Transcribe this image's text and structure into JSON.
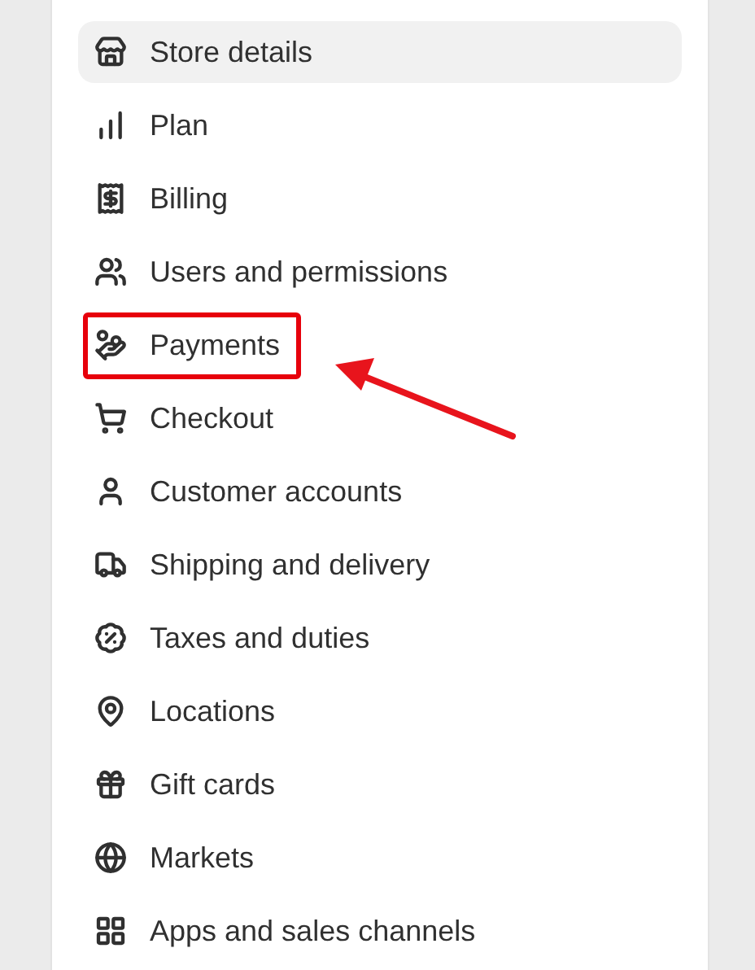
{
  "settings_menu": {
    "items": [
      {
        "label": "Store details",
        "selected": true,
        "highlighted": false
      },
      {
        "label": "Plan",
        "selected": false,
        "highlighted": false
      },
      {
        "label": "Billing",
        "selected": false,
        "highlighted": false
      },
      {
        "label": "Users and permissions",
        "selected": false,
        "highlighted": false
      },
      {
        "label": "Payments",
        "selected": false,
        "highlighted": true
      },
      {
        "label": "Checkout",
        "selected": false,
        "highlighted": false
      },
      {
        "label": "Customer accounts",
        "selected": false,
        "highlighted": false
      },
      {
        "label": "Shipping and delivery",
        "selected": false,
        "highlighted": false
      },
      {
        "label": "Taxes and duties",
        "selected": false,
        "highlighted": false
      },
      {
        "label": "Locations",
        "selected": false,
        "highlighted": false
      },
      {
        "label": "Gift cards",
        "selected": false,
        "highlighted": false
      },
      {
        "label": "Markets",
        "selected": false,
        "highlighted": false
      },
      {
        "label": "Apps and sales channels",
        "selected": false,
        "highlighted": false
      }
    ]
  }
}
